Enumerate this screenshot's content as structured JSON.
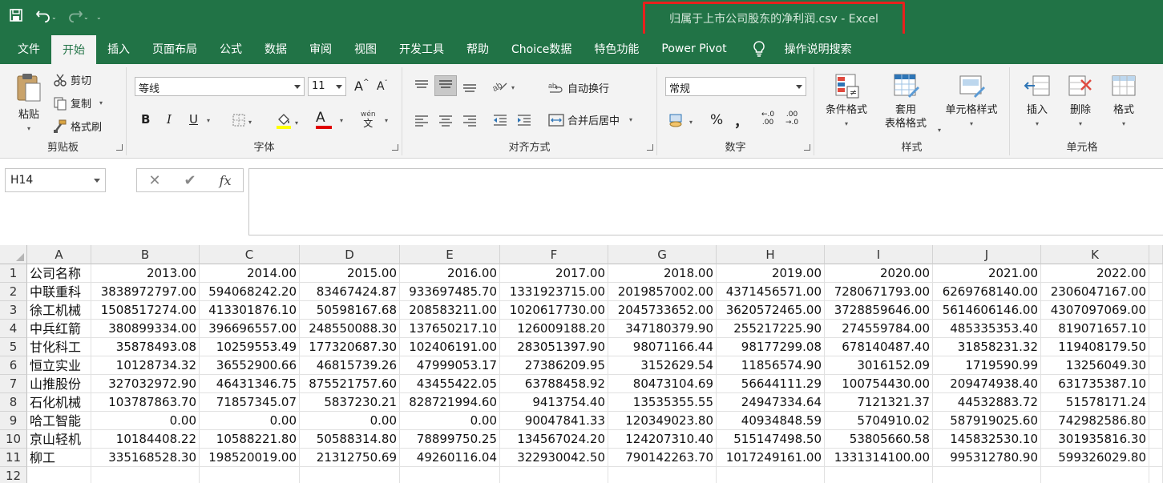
{
  "qat": {
    "undo_caret": "⌄",
    "redo_caret": "⌄",
    "custom_caret": "⌄"
  },
  "window_title": "归属于上市公司股东的净利润.csv  -  Excel",
  "tabs": [
    "文件",
    "开始",
    "插入",
    "页面布局",
    "公式",
    "数据",
    "审阅",
    "视图",
    "开发工具",
    "帮助",
    "Choice数据",
    "特色功能",
    "Power Pivot"
  ],
  "tab_search": "操作说明搜索",
  "clipboard": {
    "paste": "粘贴",
    "cut": "剪切",
    "copy": "复制",
    "format_painter": "格式刷",
    "label": "剪贴板"
  },
  "font": {
    "name": "等线",
    "size": "11",
    "label": "字体",
    "bold": "B",
    "italic": "I",
    "underline": "U",
    "grow": "A",
    "shrink": "A",
    "phonetic_top": "wén",
    "phonetic_bottom": "文",
    "font_color_letter": "A"
  },
  "alignment": {
    "wrap": "自动换行",
    "merge": "合并后居中",
    "label": "对齐方式"
  },
  "number": {
    "format": "常规",
    "label": "数字",
    "percent": "%",
    "comma": "，",
    "inc_decimal": "←.0",
    "inc_decimal_b": ".00",
    "dec_decimal": ".00",
    "dec_decimal_b": "→.0"
  },
  "styles": {
    "conditional": "条件格式",
    "table_a": "套用",
    "table_b": "表格格式",
    "cell_styles": "单元格样式",
    "label": "样式"
  },
  "cells": {
    "insert": "插入",
    "delete": "删除",
    "format": "格式",
    "label": "单元格"
  },
  "formula_bar": {
    "name_box": "H14",
    "cancel": "✕",
    "enter": "✔",
    "fx": "fx",
    "value": ""
  },
  "sheet": {
    "columns": [
      "A",
      "B",
      "C",
      "D",
      "E",
      "F",
      "G",
      "H",
      "I",
      "J",
      "K"
    ],
    "row_numbers": [
      "1",
      "2",
      "3",
      "4",
      "5",
      "6",
      "7",
      "8",
      "9",
      "10",
      "11",
      "12"
    ],
    "rows": [
      [
        "公司名称",
        "2013.00",
        "2014.00",
        "2015.00",
        "2016.00",
        "2017.00",
        "2018.00",
        "2019.00",
        "2020.00",
        "2021.00",
        "2022.00"
      ],
      [
        "中联重科",
        "3838972797.00",
        "594068242.20",
        "83467424.87",
        "933697485.70",
        "1331923715.00",
        "2019857002.00",
        "4371456571.00",
        "7280671793.00",
        "6269768140.00",
        "2306047167.00"
      ],
      [
        "徐工机械",
        "1508517274.00",
        "413301876.10",
        "50598167.68",
        "208583211.00",
        "1020617730.00",
        "2045733652.00",
        "3620572465.00",
        "3728859646.00",
        "5614606146.00",
        "4307097069.00"
      ],
      [
        "中兵红箭",
        "380899334.00",
        "396696557.00",
        "248550088.30",
        "137650217.10",
        "126009188.20",
        "347180379.90",
        "255217225.90",
        "274559784.00",
        "485335353.40",
        "819071657.10"
      ],
      [
        "甘化科工",
        "35878493.08",
        "10259553.49",
        "177320687.30",
        "102406191.00",
        "283051397.90",
        "98071166.44",
        "98177299.08",
        "678140487.40",
        "31858231.32",
        "119408179.50"
      ],
      [
        "恒立实业",
        "10128734.32",
        "36552900.66",
        "46815739.26",
        "47999053.17",
        "27386209.95",
        "3152629.54",
        "11856574.90",
        "3016152.09",
        "1719590.99",
        "13256049.30"
      ],
      [
        "山推股份",
        "327032972.90",
        "46431346.75",
        "875521757.60",
        "43455422.05",
        "63788458.92",
        "80473104.69",
        "56644111.29",
        "100754430.00",
        "209474938.40",
        "631735387.10"
      ],
      [
        "石化机械",
        "103787863.70",
        "71857345.07",
        "5837230.21",
        "828721994.60",
        "9413754.40",
        "13535355.55",
        "24947334.64",
        "7121321.37",
        "44532883.72",
        "51578171.24"
      ],
      [
        "哈工智能",
        "0.00",
        "0.00",
        "0.00",
        "0.00",
        "90047841.33",
        "120349023.80",
        "40934848.59",
        "5704910.02",
        "587919025.60",
        "742982586.80"
      ],
      [
        "京山轻机",
        "10184408.22",
        "10588221.80",
        "50588314.80",
        "78899750.25",
        "134567024.20",
        "124207310.40",
        "515147498.50",
        "53805660.58",
        "145832530.10",
        "301935816.30"
      ],
      [
        "柳工",
        "335168528.30",
        "198520019.00",
        "21312750.69",
        "49260116.04",
        "322930042.50",
        "790142263.70",
        "1017249161.00",
        "1331314100.00",
        "995312780.90",
        "599326029.80"
      ],
      [
        "",
        "",
        "",
        "",
        "",
        "",
        "",
        "",
        "",
        "",
        ""
      ]
    ]
  }
}
